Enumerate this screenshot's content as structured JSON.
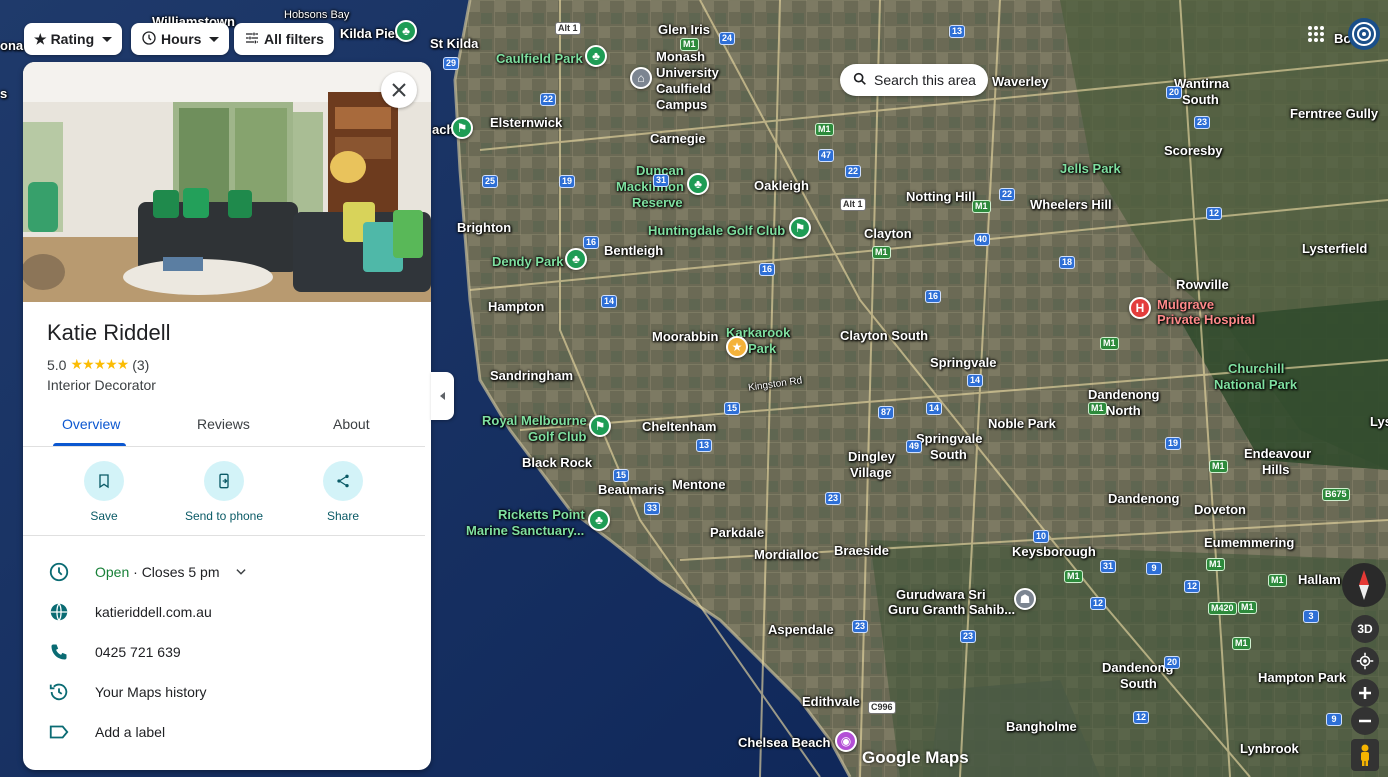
{
  "filters": {
    "rating": "Rating",
    "hours": "Hours",
    "all_filters": "All filters"
  },
  "search_area": "Search this area",
  "panel": {
    "title": "Katie Riddell",
    "rating_value": "5.0",
    "stars": "★★★★★",
    "review_count": "(3)",
    "category": "Interior Decorator",
    "tabs": [
      "Overview",
      "Reviews",
      "About"
    ],
    "actions": [
      "Save",
      "Send to phone",
      "Share"
    ],
    "hours_status": "Open",
    "hours_detail": "· Closes 5 pm",
    "website": "katieriddell.com.au",
    "phone": "0425 721 639",
    "history": "Your Maps history",
    "label": "Add a label"
  },
  "map": {
    "logo": "Google Maps",
    "btn_3d": "3D",
    "places": [
      "Williamstown",
      "Hobsons Bay",
      "Kilda Pier",
      "St Kilda",
      "Glen Iris",
      "Caulfield Park",
      "Monash",
      "University",
      "Caulfield",
      "Campus",
      "Elsternwick",
      "Carnegie",
      "Waverley",
      "Wantirna",
      "South",
      "Ferntree Gully",
      "Scoresby",
      "Jells Park",
      "Duncan",
      "Mackinnon",
      "Reserve",
      "Oakleigh",
      "Notting Hill",
      "Wheelers Hill",
      "Brighton",
      "Bentleigh",
      "Huntingdale Golf Club",
      "Clayton",
      "Dendy Park",
      "Lysterfield",
      "Rowville",
      "Mulgrave",
      "Private Hospital",
      "Hampton",
      "Moorabbin",
      "Karkarook",
      "Park",
      "Clayton South",
      "Springvale",
      "Churchill",
      "National Park",
      "Sandringham",
      "Dandenong",
      "North",
      "Noble Park",
      "Royal Melbourne",
      "Golf Club",
      "Cheltenham",
      "Springvale",
      "South",
      "Endeavour",
      "Hills",
      "Black Rock",
      "Dingley",
      "Village",
      "Beaumaris",
      "Mentone",
      "Dandenong",
      "Doveton",
      "Ricketts Point",
      "Marine Sanctuary...",
      "Parkdale",
      "Eumemmering",
      "Mordialloc",
      "Braeside",
      "Keysborough",
      "Hallam",
      "Gurudwara Sri",
      "Guru Granth Sahib...",
      "Aspendale",
      "Dandenong",
      "South",
      "Hampton Park",
      "Edithvale",
      "Bangholme",
      "Chelsea Beach",
      "Lynbrook",
      "Kingston Rd",
      "Bo",
      "ach",
      "ona",
      "s",
      "Lys"
    ],
    "shields": [
      "Alt 1",
      "M1",
      "24",
      "13",
      "29",
      "22",
      "20",
      "23",
      "M1",
      "47",
      "22",
      "25",
      "19",
      "31",
      "M1",
      "Alt 1",
      "12",
      "16",
      "40",
      "M1",
      "22",
      "16",
      "18",
      "14",
      "16",
      "M1",
      "14",
      "M1",
      "15",
      "87",
      "14",
      "49",
      "19",
      "M1",
      "15",
      "13",
      "23",
      "33",
      "10",
      "M1",
      "31",
      "M1",
      "M1",
      "9",
      "12",
      "M1",
      "M420",
      "12",
      "3",
      "23",
      "C996",
      "B675",
      "M1",
      "9",
      "23",
      "20",
      "12"
    ]
  }
}
